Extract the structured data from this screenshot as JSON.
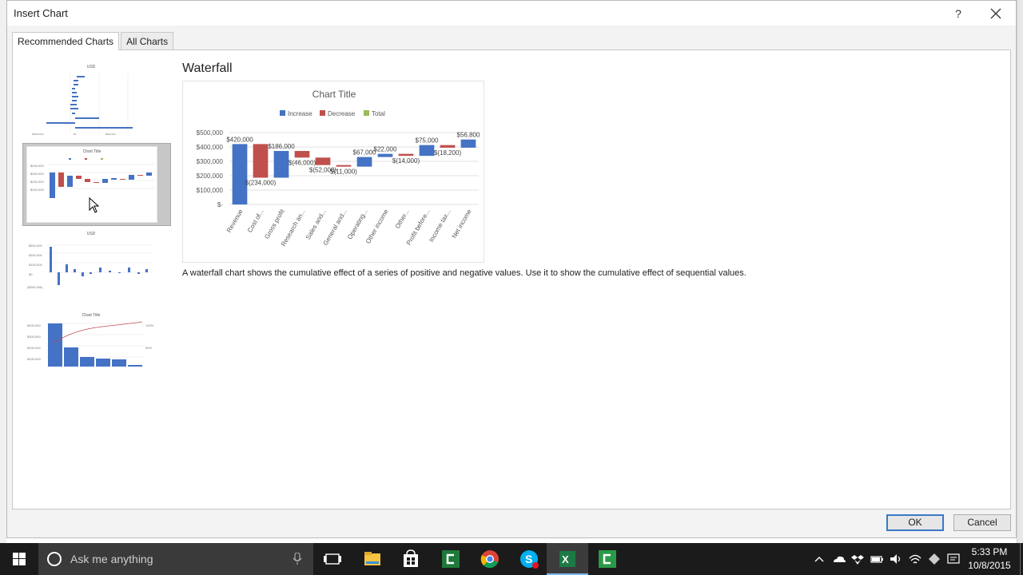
{
  "dialog": {
    "title": "Insert Chart",
    "help": "?",
    "tabs": [
      "Recommended Charts",
      "All Charts"
    ],
    "ok_label": "OK",
    "cancel_label": "Cancel"
  },
  "preview": {
    "heading": "Waterfall",
    "description": "A waterfall chart shows the cumulative effect of a series of positive and negative values. Use it to show the cumulative effect of sequential values."
  },
  "thumbnails": [
    {
      "title": "USD"
    },
    {
      "title": "Chart Title"
    },
    {
      "title": "USD"
    },
    {
      "title": "Chart Title"
    }
  ],
  "chart_data": {
    "type": "waterfall",
    "title": "Chart Title",
    "legend": [
      "Increase",
      "Decrease",
      "Total"
    ],
    "legend_position": "top",
    "colors": {
      "increase": "#4472c4",
      "decrease": "#c0504d",
      "total": "#9bbb59"
    },
    "yticks": [
      "$500,000",
      "$400,000",
      "$300,000",
      "$200,000",
      "$100,000",
      "$-"
    ],
    "ylim": [
      0,
      500000
    ],
    "categories": [
      "Revenue",
      "Cost of...",
      "Gross profit",
      "Research an...",
      "Sales and...",
      "General and...",
      "Operating...",
      "Other income",
      "Other...",
      "Profit before...",
      "Income tax...",
      "Net income"
    ],
    "values": [
      420000,
      -234000,
      186000,
      -46000,
      -52000,
      -11000,
      67000,
      22000,
      -14000,
      75000,
      -18200,
      56800
    ],
    "labels": [
      "$420,000",
      "$(234,000)",
      "$186,000",
      "$(46,000)",
      "$(52,000)",
      "$(11,000)",
      "$67,000",
      "$22,000",
      "$(14,000)",
      "$75,000",
      "$(18,200)",
      "$56,800"
    ],
    "grid": true
  },
  "taskbar": {
    "search_placeholder": "Ask me anything",
    "time": "5:33 PM",
    "date": "10/8/2015"
  }
}
